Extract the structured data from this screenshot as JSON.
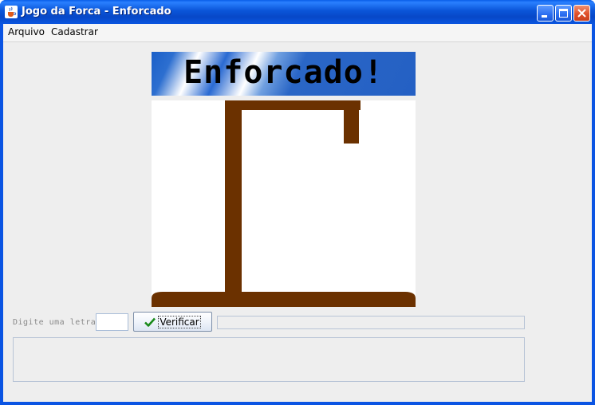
{
  "window": {
    "title": "Jogo da Forca - Enforcado",
    "icon": "java-cup-icon",
    "controls": [
      "minimize-icon",
      "maximize-icon",
      "close-icon"
    ]
  },
  "menubar": {
    "items": [
      {
        "label": "Arquivo"
      },
      {
        "label": "Cadastrar"
      }
    ]
  },
  "banner": {
    "text": "Enforcado!"
  },
  "input_row": {
    "label": "Digite uma letra:",
    "letter_value": "",
    "verify_button": "Verificar",
    "verify_icon": "checkmark-icon",
    "status_text": ""
  },
  "message_area": {
    "text": ""
  },
  "colors": {
    "titlebar": "#0a55d8",
    "gallows": "#6b3100",
    "banner_blue": "#2460c4",
    "client_bg": "#eeeeee"
  }
}
